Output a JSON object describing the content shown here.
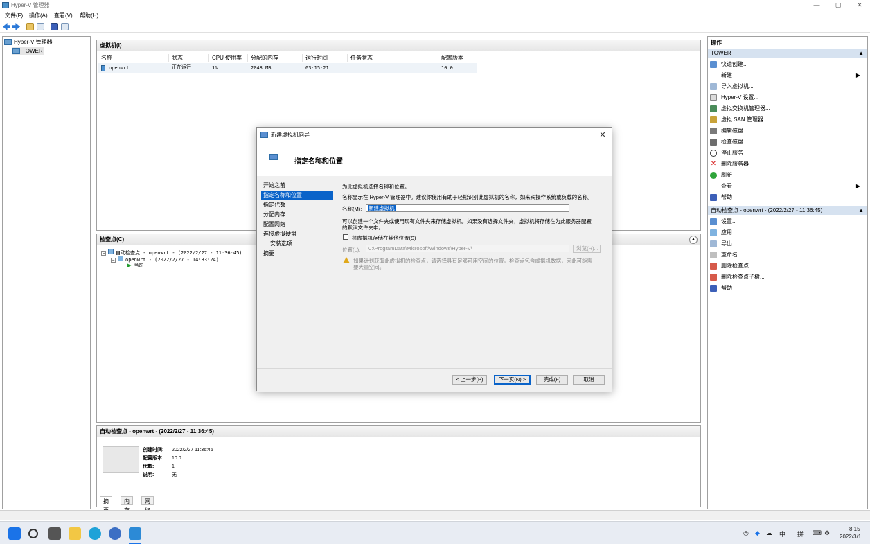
{
  "window": {
    "title": "Hyper-V 管理器",
    "min": "—",
    "max": "▢",
    "close": "✕"
  },
  "menu": [
    "文件(F)",
    "操作(A)",
    "查看(V)",
    "帮助(H)"
  ],
  "tree": {
    "root": "Hyper-V 管理器",
    "server": "TOWER"
  },
  "vm_panel": {
    "title": "虚拟机(I)",
    "columns": [
      "名称",
      "状态",
      "CPU 使用率",
      "分配的内存",
      "运行时间",
      "任务状态",
      "配置版本"
    ],
    "rows": [
      {
        "name": "openwrt",
        "state": "正在运行",
        "cpu": "1%",
        "mem": "2048 MB",
        "uptime": "03:15:21",
        "task": "",
        "version": "10.0"
      }
    ]
  },
  "checkpoints": {
    "title": "检查点(C)",
    "items": [
      "自动检查点 - openwrt - (2022/2/27 - 11:36:45)",
      "openwrt - (2022/2/27 - 14:33:24)",
      "当前"
    ]
  },
  "details": {
    "title": "自动检查点 - openwrt - (2022/2/27 - 11:36:45)",
    "fields": [
      {
        "k": "创建时间:",
        "v": "2022/2/27 11:36:45"
      },
      {
        "k": "配置版本:",
        "v": "10.0"
      },
      {
        "k": "代数:",
        "v": "1"
      },
      {
        "k": "说明:",
        "v": "无"
      }
    ],
    "tabs": [
      "摘要",
      "内存",
      "网络"
    ]
  },
  "actions": {
    "title": "操作",
    "section1": "TOWER",
    "items1": [
      "快速创建...",
      "新建",
      "导入虚拟机...",
      "Hyper-V 设置...",
      "虚拟交换机管理器...",
      "虚拟 SAN 管理器...",
      "编辑磁盘...",
      "检查磁盘...",
      "停止服务",
      "删除服务器",
      "刷新",
      "查看",
      "帮助"
    ],
    "section2": "自动检查点 - openwrt - (2022/2/27 - 11:36:45)",
    "items2": [
      "设置...",
      "应用...",
      "导出...",
      "重命名...",
      "删除检查点...",
      "删除检查点子树...",
      "帮助"
    ]
  },
  "dialog": {
    "title": "新建虚拟机向导",
    "heading": "指定名称和位置",
    "steps": [
      "开始之前",
      "指定名称和位置",
      "指定代数",
      "分配内存",
      "配置网络",
      "连接虚拟硬盘",
      "安装选项",
      "摘要"
    ],
    "intro": "为此虚拟机选择名称和位置。",
    "desc": "名称显示在 Hyper-V 管理器中。建议你使用有助于轻松识别此虚拟机的名称，如来宾操作系统或负载的名称。",
    "name_label": "名称(M):",
    "name_value": "新建虚拟机",
    "folder_text1": "可以创建一个文件夹或使用现有文件夹来存储虚拟机。如果没有选择文件夹，虚拟机将存储在为此服务器配置",
    "folder_text2": "的默认文件夹中。",
    "checkbox_label": "将虚拟机存储在其他位置(S)",
    "location_label": "位置(L):",
    "location_value": "C:\\ProgramData\\Microsoft\\Windows\\Hyper-V\\",
    "browse": "浏览(R)...",
    "warning1": "如果计划获取此虚拟机的检查点，请选择具有足够可用空间的位置。检查点包含虚拟机数据，因此可能需",
    "warning2": "要大量空间。",
    "buttons": {
      "prev": "< 上一步(P)",
      "next": "下一页(N) >",
      "finish": "完成(F)",
      "cancel": "取消"
    }
  },
  "taskbar": {
    "time": "8:15",
    "date": "2022/3/1",
    "ime1": "中",
    "ime2": "拼"
  },
  "colors": {
    "accent": "#0a63c9",
    "panel_border": "#a0a0a0"
  }
}
